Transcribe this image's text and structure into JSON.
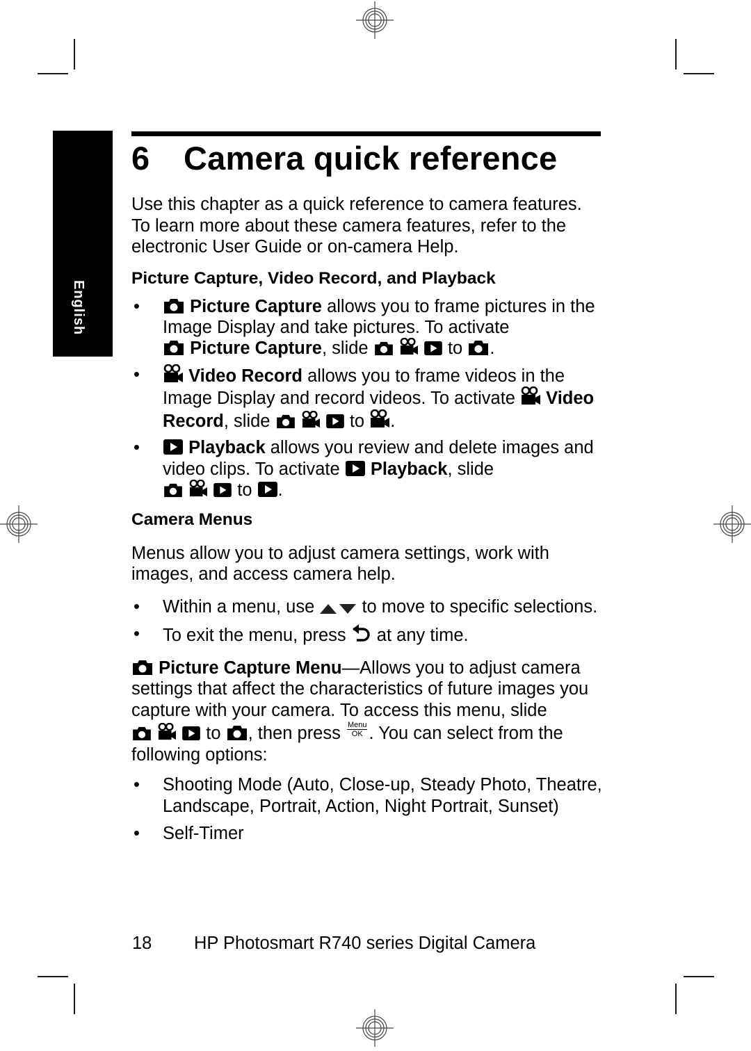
{
  "side_tab": {
    "label": "English"
  },
  "chapter": {
    "number": "6",
    "title": "Camera quick reference"
  },
  "intro": "Use this chapter as a quick reference to camera features. To learn more about these camera features, refer to the electronic User Guide or on-camera Help.",
  "section1": {
    "heading": "Picture Capture, Video Record, and Playback",
    "items": [
      {
        "icon": "camera-icon",
        "name": "Picture Capture",
        "text1": " allows you to frame pictures in the Image Display and take pictures. To activate ",
        "name2": "Picture Capture",
        "text2": ", slide ",
        "to": " to ",
        "target_icon": "camera-icon",
        "end": "."
      },
      {
        "icon": "video-camera-icon",
        "name": "Video Record",
        "text1": " allows you to frame videos in the Image Display and record videos. To activate ",
        "name2": "Video Record",
        "text2": ", slide ",
        "to": " to ",
        "target_icon": "video-camera-icon",
        "end": "."
      },
      {
        "icon": "playback-icon",
        "name": "Playback",
        "text1": " allows you review and delete images and video clips. To activate ",
        "name2": "Playback",
        "text2": ", slide ",
        "to": " to ",
        "target_icon": "playback-icon",
        "end": "."
      }
    ]
  },
  "section2": {
    "heading": "Camera Menus",
    "intro": "Menus allow you to adjust camera settings, work with images, and access camera help.",
    "bullets": [
      {
        "before": "Within a menu, use ",
        "icon": "up-down-arrows-icon",
        "after": " to move to specific selections."
      },
      {
        "before": "To exit the menu, press ",
        "icon": "back-arrow-icon",
        "after": " at any time."
      }
    ],
    "menu_para": {
      "name": "Picture Capture Menu",
      "text1": "—Allows you to adjust camera settings that affect the characteristics of future images you capture with your camera. To access this menu, slide ",
      "to": " to ",
      "text2": ", then press ",
      "menu_label": "Menu",
      "ok_label": "OK",
      "text3": ". You can select from the following options:"
    },
    "options": [
      "Shooting Mode (Auto, Close-up, Steady Photo, Theatre, Landscape, Portrait, Action, Night Portrait, Sunset)",
      "Self-Timer"
    ]
  },
  "footer": {
    "page_number": "18",
    "product": "HP Photosmart R740 series Digital Camera"
  },
  "bullet_char": "•"
}
